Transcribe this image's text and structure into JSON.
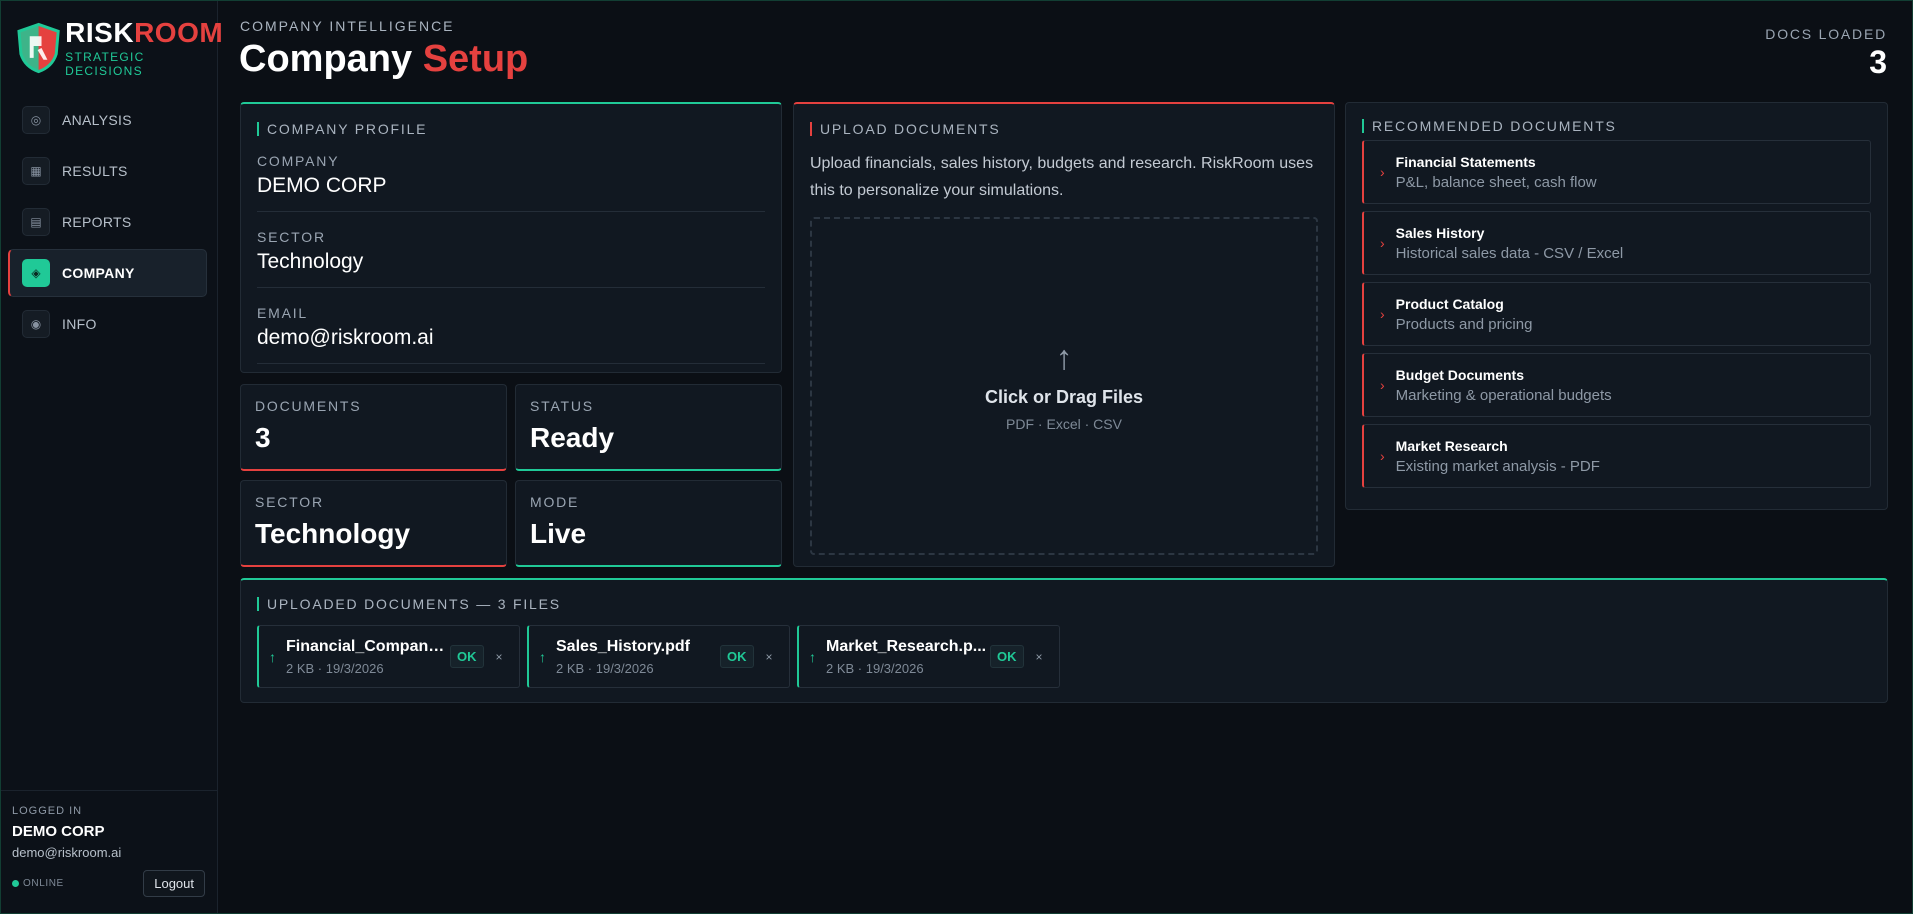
{
  "brand": {
    "name_part1": "RISK",
    "name_part2": "ROOM",
    "tagline": "STRATEGIC DECISIONS"
  },
  "nav": {
    "items": [
      {
        "label": "ANALYSIS",
        "icon": "target-icon"
      },
      {
        "label": "RESULTS",
        "icon": "grid-icon"
      },
      {
        "label": "REPORTS",
        "icon": "document-icon"
      },
      {
        "label": "COMPANY",
        "icon": "diamond-icon",
        "active": true
      },
      {
        "label": "INFO",
        "icon": "info-icon"
      }
    ]
  },
  "user": {
    "caption": "LOGGED IN",
    "company": "DEMO CORP",
    "email": "demo@riskroom.ai",
    "status": "ONLINE",
    "logout_label": "Logout"
  },
  "header": {
    "breadcrumb": "COMPANY INTELLIGENCE",
    "title_part1": "Company",
    "title_part2": "Setup",
    "docs_loaded_label": "DOCS LOADED",
    "docs_loaded_value": "3"
  },
  "profile": {
    "title": "COMPANY PROFILE",
    "fields": [
      {
        "label": "COMPANY",
        "value": "DEMO CORP"
      },
      {
        "label": "SECTOR",
        "value": "Technology"
      },
      {
        "label": "EMAIL",
        "value": "demo@riskroom.ai"
      }
    ]
  },
  "stats": [
    {
      "label": "DOCUMENTS",
      "value": "3"
    },
    {
      "label": "STATUS",
      "value": "Ready"
    },
    {
      "label": "SECTOR",
      "value": "Technology"
    },
    {
      "label": "MODE",
      "value": "Live"
    }
  ],
  "upload": {
    "title": "UPLOAD DOCUMENTS",
    "description": "Upload financials, sales history, budgets and research. RiskRoom uses this to personalize your simulations.",
    "drop_title": "Click or Drag Files",
    "drop_formats": "PDF · Excel · CSV"
  },
  "recommended": {
    "title": "RECOMMENDED DOCUMENTS",
    "items": [
      {
        "name": "Financial Statements",
        "desc": "P&L, balance sheet, cash flow"
      },
      {
        "name": "Sales History",
        "desc": "Historical sales data - CSV / Excel"
      },
      {
        "name": "Product Catalog",
        "desc": "Products and pricing"
      },
      {
        "name": "Budget Documents",
        "desc": "Marketing & operational budgets"
      },
      {
        "name": "Market Research",
        "desc": "Existing market analysis - PDF"
      }
    ]
  },
  "uploaded": {
    "title": "UPLOADED DOCUMENTS — 3 FILES",
    "files": [
      {
        "name": "Financial_Company...",
        "meta": "2 KB · 19/3/2026",
        "status": "OK",
        "remove": "×"
      },
      {
        "name": "Sales_History.pdf",
        "meta": "2 KB · 19/3/2026",
        "status": "OK",
        "remove": "×"
      },
      {
        "name": "Market_Research.p...",
        "meta": "2 KB · 19/3/2026",
        "status": "OK",
        "remove": "×"
      }
    ]
  },
  "colors": {
    "accent_red": "#e5413f",
    "accent_teal": "#20c997",
    "background": "#0b0f15",
    "panel": "#111821"
  }
}
